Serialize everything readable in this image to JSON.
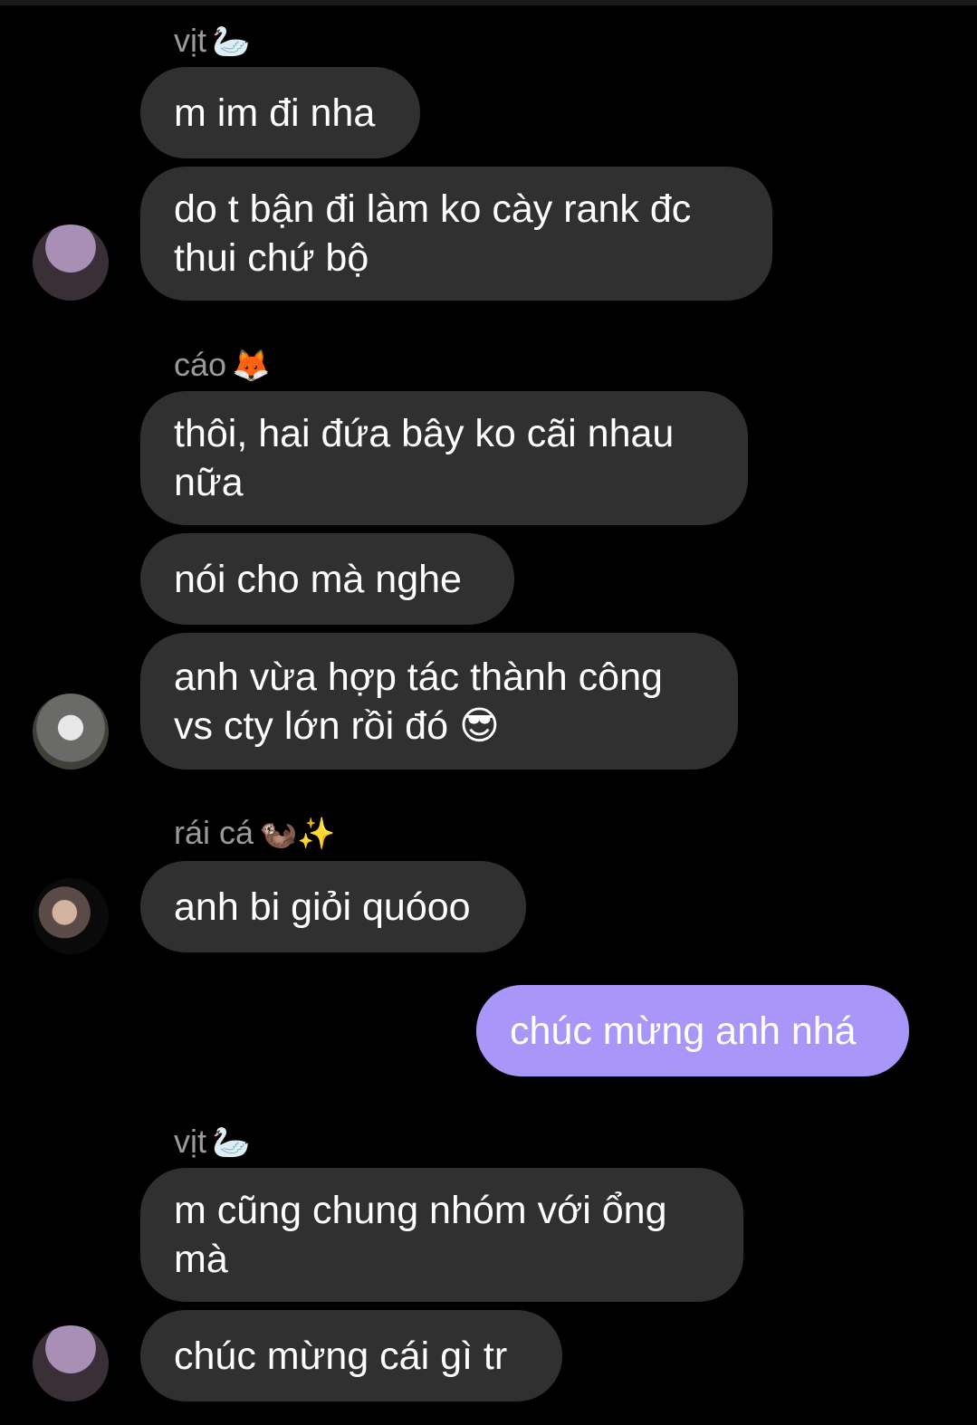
{
  "groups": [
    {
      "sender": "vịt",
      "sender_emoji": "🦢",
      "messages": [
        "m im đi nha",
        "do t bận đi làm ko cày rank đc thui chứ bộ"
      ]
    },
    {
      "sender": "cáo",
      "sender_emoji": "🦊",
      "messages": [
        "thôi, hai đứa bây ko cãi nhau nữa",
        "nói cho mà nghe",
        "anh vừa hợp tác thành công vs cty lớn rồi đó 😎"
      ]
    },
    {
      "sender": "rái cá",
      "sender_emoji": "🦦✨",
      "messages": [
        "anh bi giỏi quóoo"
      ]
    },
    {
      "sender": "me",
      "messages": [
        "chúc mừng anh nhá"
      ]
    },
    {
      "sender": "vịt",
      "sender_emoji": "🦢",
      "messages": [
        "m cũng chung nhóm với ổng mà",
        "chúc mừng cái gì tr"
      ]
    }
  ],
  "colors": {
    "background": "#000000",
    "bubble_incoming": "#303030",
    "bubble_outgoing": "#a996f9",
    "sender_name": "#9a9a9a"
  }
}
